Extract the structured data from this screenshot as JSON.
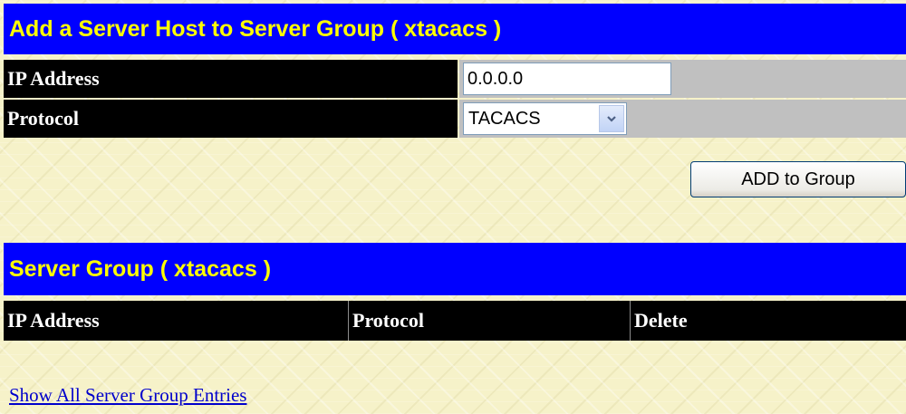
{
  "add_section": {
    "title": "Add a Server Host to Server Group ( xtacacs )",
    "ip_address_label": "IP Address",
    "ip_address_value": "0.0.0.0",
    "protocol_label": "Protocol",
    "protocol_selected": "TACACS",
    "add_button_label": "ADD to Group"
  },
  "group_section": {
    "title": "Server Group ( xtacacs )",
    "columns": [
      "IP Address",
      "Protocol",
      "Delete"
    ],
    "rows": []
  },
  "links": {
    "show_all": "Show All Server Group Entries"
  },
  "colors": {
    "title_bar_bg": "#0000ff",
    "title_text": "#ffff00",
    "label_bg": "#000000",
    "value_bg": "#c0c0c0",
    "page_bg": "#f6f2c9",
    "link": "#0000cc"
  },
  "icons": {
    "select_arrow": "chevron-down-icon"
  }
}
